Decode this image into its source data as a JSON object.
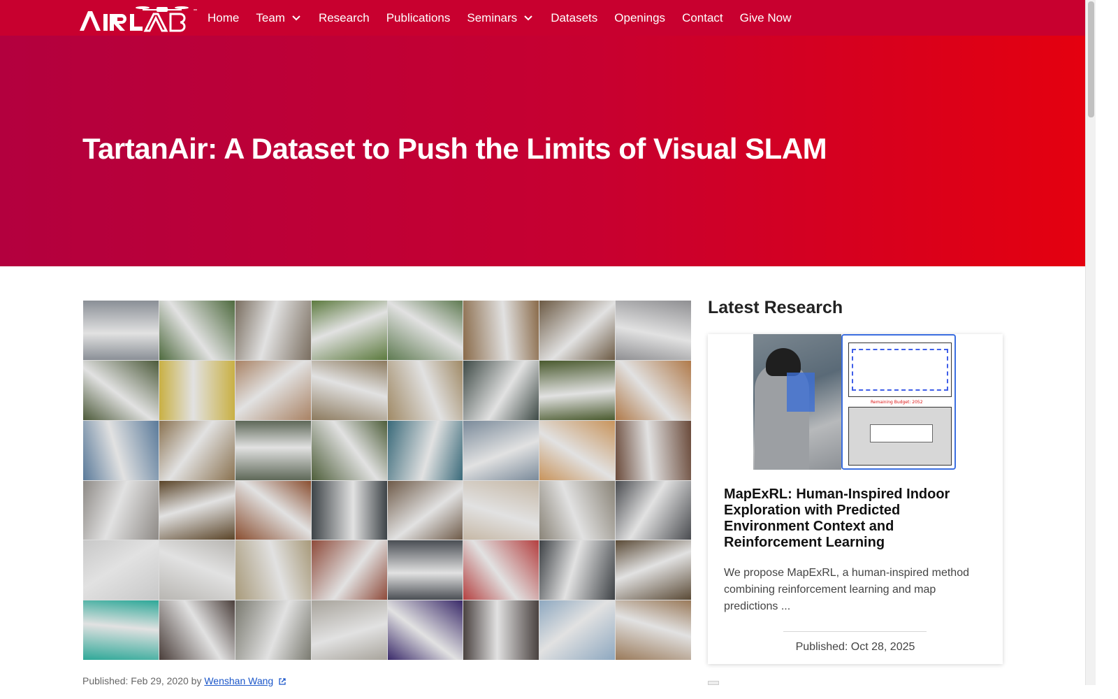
{
  "logo_text": "AIRLAB",
  "nav": {
    "items": [
      {
        "label": "Home",
        "dropdown": false
      },
      {
        "label": "Team",
        "dropdown": true
      },
      {
        "label": "Research",
        "dropdown": false
      },
      {
        "label": "Publications",
        "dropdown": false
      },
      {
        "label": "Seminars",
        "dropdown": true
      },
      {
        "label": "Datasets",
        "dropdown": false
      },
      {
        "label": "Openings",
        "dropdown": false
      },
      {
        "label": "Contact",
        "dropdown": false
      },
      {
        "label": "Give Now",
        "dropdown": false
      }
    ]
  },
  "hero": {
    "title": "TartanAir: A Dataset to Push the Limits of Visual SLAM"
  },
  "post": {
    "published_prefix": "Published: Feb 29, 2020 by ",
    "author": "Wenshan Wang"
  },
  "sidebar": {
    "heading": "Latest Research",
    "card": {
      "title": "MapExRL: Human-Inspired Indoor Exploration with Predicted Environment Context and Reinforcement Learning",
      "description": "We propose MapExRL, a human-inspired method combining reinforcement learning and map predictions ...",
      "date": "Published: Oct 28, 2025",
      "figure_text": "Remaining Budget: 2052"
    }
  },
  "colors": {
    "brand_red": "#c8002f",
    "link_blue": "#1a56c9"
  },
  "mosaic_colors": [
    [
      "#8a8f96",
      "#4e6a3e",
      "#7a6e60",
      "#5c7a3e",
      "#5f7b52",
      "#8a6b4a",
      "#6c5a44",
      "#8f8f92"
    ],
    [
      "#4c5a3a",
      "#c9b044",
      "#a98264",
      "#8c7a5e",
      "#a08a66",
      "#3e4a46",
      "#4a5a2e",
      "#b07a4a"
    ],
    [
      "#5a7a9a",
      "#8a7250",
      "#5e6858",
      "#4e5e3a",
      "#3a6a7a",
      "#7a8a9a",
      "#c8945c",
      "#6a4a3a"
    ],
    [
      "#8e8a86",
      "#5a4428",
      "#8a4e30",
      "#3e4448",
      "#6e5a48",
      "#c6b8a6",
      "#8a8478",
      "#4a4c50"
    ],
    [
      "#c8c8c8",
      "#b8b6b2",
      "#a89a7a",
      "#8e4a3a",
      "#4a4e54",
      "#b44040",
      "#3e4246",
      "#5a4a36"
    ],
    [
      "#2ea898",
      "#4a3e3a",
      "#7a7a70",
      "#a8a49c",
      "#3a2a6a",
      "#4a4240",
      "#8ea8c0",
      "#9a7a5a"
    ]
  ]
}
